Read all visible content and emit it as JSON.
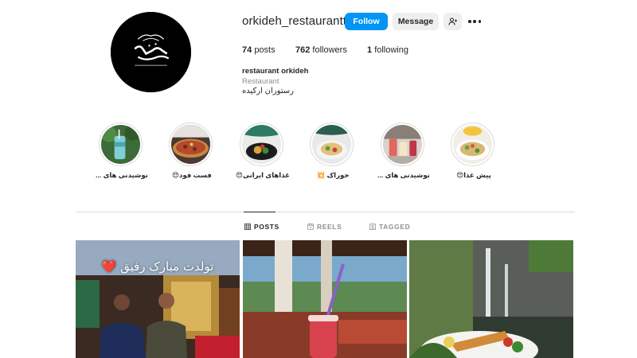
{
  "profile": {
    "username": "orkideh_restaurantt",
    "follow_label": "Follow",
    "message_label": "Message",
    "posts_count": "74",
    "posts_label": "posts",
    "followers_count": "762",
    "followers_label": "followers",
    "following_count": "1",
    "following_label": "following",
    "name": "restaurant orkideh",
    "category": "Restaurant",
    "bio": "رستوران ارکیده"
  },
  "highlights": [
    {
      "label": "نوشیدنی های ...",
      "icon": "drink-image"
    },
    {
      "label": "فست فود😍",
      "icon": "pizza-image"
    },
    {
      "label": "غذاهای ایرانی😍",
      "icon": "persian-food-image"
    },
    {
      "label": "خوراک 💥",
      "icon": "dish-image"
    },
    {
      "label": "نوشیدنی های ...",
      "icon": "drinks-image"
    },
    {
      "label": "پیش غذا😍",
      "icon": "appetizer-image"
    }
  ],
  "tabs": {
    "posts": "POSTS",
    "reels": "REELS",
    "tagged": "TAGGED"
  },
  "posts": [
    {
      "caption": "تولدت مبارک رفیق ❤️",
      "icon": "birthday-photo"
    },
    {
      "caption": "",
      "icon": "restaurant-interior-photo"
    },
    {
      "caption": "",
      "icon": "waterfall-dish-photo"
    }
  ],
  "colors": {
    "accent": "#0095f6",
    "secondary_button": "#efefef",
    "text": "#262626",
    "muted": "#8e8e8e",
    "divider": "#dbdbdb"
  }
}
